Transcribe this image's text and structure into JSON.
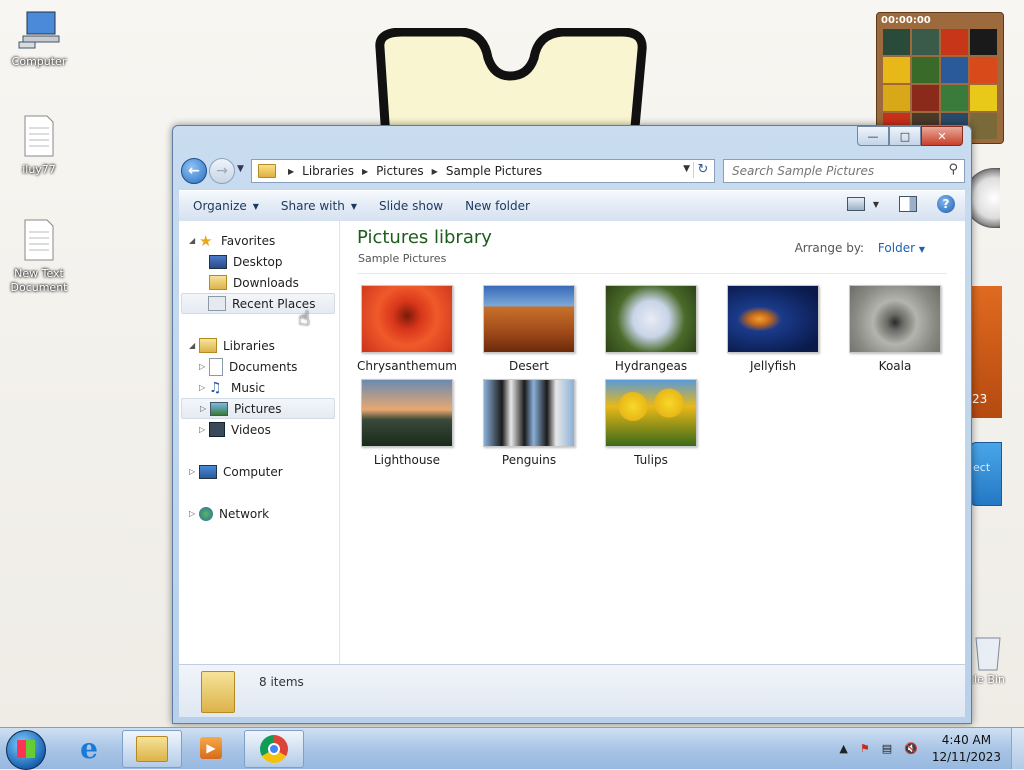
{
  "desktop": {
    "icons": [
      {
        "label": "Computer"
      },
      {
        "label": "iluy77"
      },
      {
        "label": "New Text Document"
      }
    ],
    "recycle_bin_label": "cle Bin",
    "gadgets": {
      "puzzle_timer": "00:00:00",
      "calendar_fragment": "23",
      "blue_fragment": "ect"
    }
  },
  "window": {
    "caption_buttons": {
      "minimize": "minimize",
      "maximize": "maximize",
      "close": "close"
    },
    "breadcrumb": [
      "Libraries",
      "Pictures",
      "Sample Pictures"
    ],
    "search_placeholder": "Search Sample Pictures",
    "toolbar": {
      "organize": "Organize",
      "share_with": "Share with",
      "slide_show": "Slide show",
      "new_folder": "New folder"
    },
    "nav": {
      "favorites": "Favorites",
      "desktop": "Desktop",
      "downloads": "Downloads",
      "recent_places": "Recent Places",
      "libraries": "Libraries",
      "documents": "Documents",
      "music": "Music",
      "pictures": "Pictures",
      "videos": "Videos",
      "computer": "Computer",
      "network": "Network"
    },
    "library": {
      "title": "Pictures library",
      "subtitle": "Sample Pictures",
      "arrange_label": "Arrange by:",
      "arrange_value": "Folder"
    },
    "items": [
      {
        "name": "Chrysanthemum",
        "color": "#d8361a"
      },
      {
        "name": "Desert",
        "color": "#b45a28"
      },
      {
        "name": "Hydrangeas",
        "color": "#5e7a3a"
      },
      {
        "name": "Jellyfish",
        "color": "#1a3a8a"
      },
      {
        "name": "Koala",
        "color": "#8a8a84"
      },
      {
        "name": "Lighthouse",
        "color": "#3e5a7a"
      },
      {
        "name": "Penguins",
        "color": "#6a90b8"
      },
      {
        "name": "Tulips",
        "color": "#e8b818"
      }
    ],
    "status": {
      "count": "8 items"
    }
  },
  "taskbar": {
    "time": "4:40 AM",
    "date": "12/11/2023"
  }
}
